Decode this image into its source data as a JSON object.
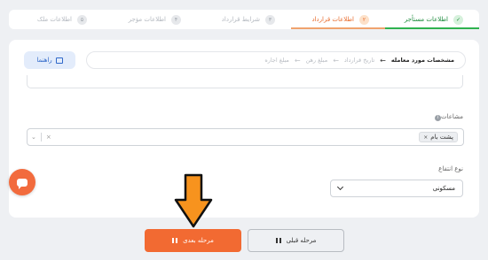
{
  "stepper": {
    "steps": [
      {
        "num": "✓",
        "label": "اطلاعات مستأجر"
      },
      {
        "num": "۲",
        "label": "اطلاعات قرارداد"
      },
      {
        "num": "۳",
        "label": "شرایط قرارداد"
      },
      {
        "num": "۴",
        "label": "اطلاعات مؤجر"
      },
      {
        "num": "۵",
        "label": "اطلاعات ملک"
      }
    ]
  },
  "guide": {
    "label": "راهنما"
  },
  "subnav": {
    "current": "مشخصات مورد معامله",
    "items": [
      "تاریخ قرارداد",
      "مبلغ رهن",
      "مبلغ اجاره"
    ],
    "arrow": "←"
  },
  "amenities": {
    "label": "مشاعات",
    "info": "i",
    "selected_tag": "پشت بام",
    "tag_remove": "×",
    "clear": "×",
    "dropdown": "⌄"
  },
  "usage": {
    "label": "نوع انتفاع",
    "value": "مسکونی"
  },
  "buttons": {
    "next": "مرحله بعدی",
    "prev": "مرحله قبلی"
  },
  "colors": {
    "accent": "#f26a32",
    "done": "#2fb24f",
    "guide": "#2f68c9"
  }
}
